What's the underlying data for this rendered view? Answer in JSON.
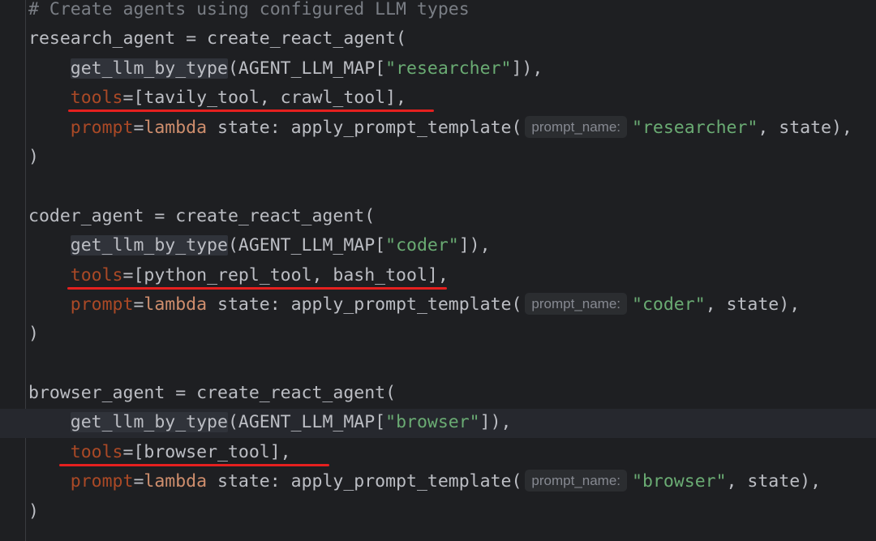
{
  "editor": {
    "hint_label": "prompt_name:",
    "annotation_color": "#e5201f",
    "lines": {
      "comment": "# Create agents using configured LLM types",
      "research_decl": "research_agent = create_react_agent(",
      "research_llm_fn": "get_llm_by_type",
      "research_llm_open": "(AGENT_LLM_MAP[",
      "research_llm_key": "\"researcher\"",
      "research_llm_close": "]),",
      "research_tools_kw": "tools",
      "research_tools_val": "=[tavily_tool, crawl_tool],",
      "research_prompt_kw": "prompt",
      "research_prompt_eq": "=",
      "research_lambda": "lambda",
      "research_prompt_call": " state: apply_prompt_template(",
      "research_prompt_name": "\"researcher\"",
      "research_prompt_end": ", state),",
      "research_close": ")",
      "coder_decl": "coder_agent = create_react_agent(",
      "coder_llm_fn": "get_llm_by_type",
      "coder_llm_open": "(AGENT_LLM_MAP[",
      "coder_llm_key": "\"coder\"",
      "coder_llm_close": "]),",
      "coder_tools_kw": "tools",
      "coder_tools_val": "=[python_repl_tool, bash_tool],",
      "coder_prompt_kw": "prompt",
      "coder_prompt_eq": "=",
      "coder_lambda": "lambda",
      "coder_prompt_call": " state: apply_prompt_template(",
      "coder_prompt_name": "\"coder\"",
      "coder_prompt_end": ", state),",
      "coder_close": ")",
      "browser_decl": "browser_agent = create_react_agent(",
      "browser_llm_fn": "get_llm_by_type",
      "browser_llm_open": "(AGENT_LLM_MAP[",
      "browser_llm_key": "\"browser\"",
      "browser_llm_close": "]),",
      "browser_tools_kw": "tools",
      "browser_tools_val": "=[browser_tool],",
      "browser_prompt_kw": "prompt",
      "browser_prompt_eq": "=",
      "browser_lambda": "lambda",
      "browser_prompt_call": " state: apply_prompt_template(",
      "browser_prompt_name": "\"browser\"",
      "browser_prompt_end": ", state),",
      "browser_close": ")"
    }
  }
}
